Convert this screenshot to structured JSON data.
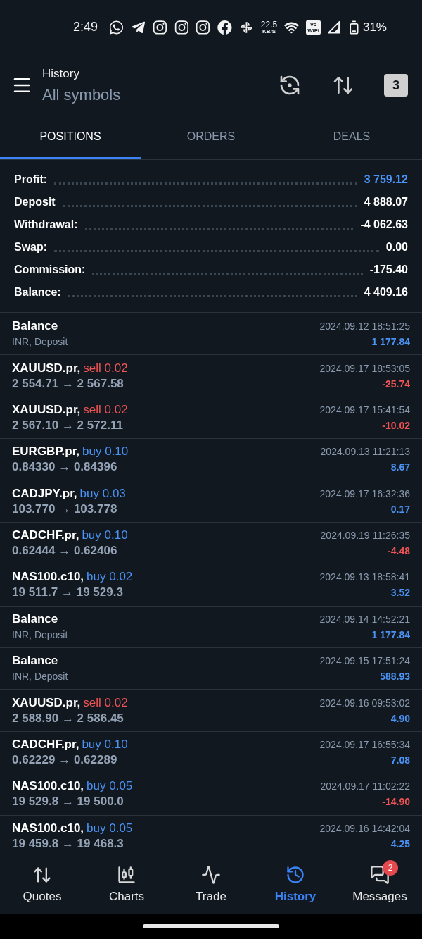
{
  "status_bar": {
    "time": "2:49",
    "speed": "22.5",
    "speed_unit": "KB/S",
    "vowifi": "Vo WiFi",
    "battery": "31%"
  },
  "app_bar": {
    "title": "History",
    "subtitle": "All symbols",
    "calendar_day": "3"
  },
  "tabs": [
    {
      "label": "POSITIONS",
      "selected": true
    },
    {
      "label": "ORDERS",
      "selected": false
    },
    {
      "label": "DEALS",
      "selected": false
    }
  ],
  "summary": [
    {
      "label": "Profit:",
      "value": "3 759.12",
      "highlight": true
    },
    {
      "label": "Deposit",
      "value": "4 888.07",
      "highlight": false
    },
    {
      "label": "Withdrawal:",
      "value": "-4 062.63",
      "highlight": false
    },
    {
      "label": "Swap:",
      "value": "0.00",
      "highlight": false
    },
    {
      "label": "Commission:",
      "value": "-175.40",
      "highlight": false
    },
    {
      "label": "Balance:",
      "value": "4 409.16",
      "highlight": false
    }
  ],
  "rows": [
    {
      "kind": "balance",
      "title": "Balance",
      "detail": "INR, Deposit",
      "time": "2024.09.12 18:51:25",
      "amount": "1 177.84",
      "loss": false
    },
    {
      "kind": "trade",
      "title": "XAUUSD.pr,",
      "sell": true,
      "order": "sell 0.02",
      "prices": "2 554.71 → 2 567.58",
      "time": "2024.09.17 18:53:05",
      "amount": "-25.74",
      "loss": true
    },
    {
      "kind": "trade",
      "title": "XAUUSD.pr,",
      "sell": true,
      "order": "sell 0.02",
      "prices": "2 567.10 → 2 572.11",
      "time": "2024.09.17 15:41:54",
      "amount": "-10.02",
      "loss": true
    },
    {
      "kind": "trade",
      "title": "EURGBP.pr,",
      "sell": false,
      "order": "buy 0.10",
      "prices": "0.84330 → 0.84396",
      "time": "2024.09.13 11:21:13",
      "amount": "8.67",
      "loss": false
    },
    {
      "kind": "trade",
      "title": "CADJPY.pr,",
      "sell": false,
      "order": "buy 0.03",
      "prices": "103.770 → 103.778",
      "time": "2024.09.17 16:32:36",
      "amount": "0.17",
      "loss": false
    },
    {
      "kind": "trade",
      "title": "CADCHF.pr,",
      "sell": false,
      "order": "buy 0.10",
      "prices": "0.62444 → 0.62406",
      "time": "2024.09.19 11:26:35",
      "amount": "-4.48",
      "loss": true
    },
    {
      "kind": "trade",
      "title": "NAS100.c10,",
      "sell": false,
      "order": "buy 0.02",
      "prices": "19 511.7 → 19 529.3",
      "time": "2024.09.13 18:58:41",
      "amount": "3.52",
      "loss": false
    },
    {
      "kind": "balance",
      "title": "Balance",
      "detail": "INR, Deposit",
      "time": "2024.09.14 14:52:21",
      "amount": "1 177.84",
      "loss": false
    },
    {
      "kind": "balance",
      "title": "Balance",
      "detail": "INR, Deposit",
      "time": "2024.09.15 17:51:24",
      "amount": "588.93",
      "loss": false
    },
    {
      "kind": "trade",
      "title": "XAUUSD.pr,",
      "sell": true,
      "order": "sell 0.02",
      "prices": "2 588.90 → 2 586.45",
      "time": "2024.09.16 09:53:02",
      "amount": "4.90",
      "loss": false
    },
    {
      "kind": "trade",
      "title": "CADCHF.pr,",
      "sell": false,
      "order": "buy 0.10",
      "prices": "0.62229 → 0.62289",
      "time": "2024.09.17 16:55:34",
      "amount": "7.08",
      "loss": false
    },
    {
      "kind": "trade",
      "title": "NAS100.c10,",
      "sell": false,
      "order": "buy 0.05",
      "prices": "19 529.8 → 19 500.0",
      "time": "2024.09.17 11:02:22",
      "amount": "-14.90",
      "loss": true
    },
    {
      "kind": "trade",
      "title": "NAS100.c10,",
      "sell": false,
      "order": "buy 0.05",
      "prices": "19 459.8 → 19 468.3",
      "time": "2024.09.16 14:42:04",
      "amount": "4.25",
      "loss": false
    }
  ],
  "nav": [
    {
      "kind": "quotes",
      "label": "Quotes",
      "selected": false
    },
    {
      "kind": "charts",
      "label": "Charts",
      "selected": false
    },
    {
      "kind": "trade",
      "label": "Trade",
      "selected": false
    },
    {
      "kind": "history",
      "label": "History",
      "selected": true
    },
    {
      "kind": "messages",
      "label": "Messages",
      "selected": false,
      "badge": "2"
    }
  ]
}
